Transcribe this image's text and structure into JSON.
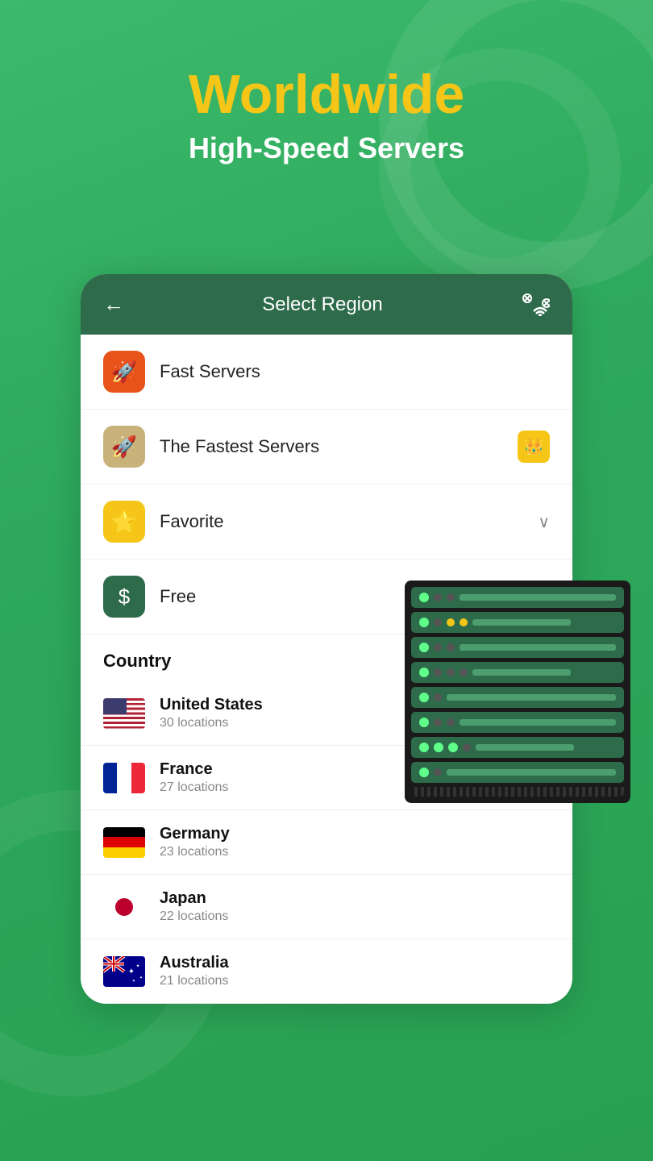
{
  "header": {
    "title": "Worldwide",
    "subtitle": "High-Speed Servers"
  },
  "card": {
    "back_label": "←",
    "title": "Select Region",
    "menu_items": [
      {
        "id": "fast",
        "label": "Fast Servers",
        "icon_type": "orange",
        "icon": "🚀",
        "right": ""
      },
      {
        "id": "fastest",
        "label": "The Fastest Servers",
        "icon_type": "tan",
        "icon": "🚀",
        "right": "crown"
      },
      {
        "id": "favorite",
        "label": "Favorite",
        "icon_type": "yellow",
        "icon": "⭐",
        "right": "chevron"
      },
      {
        "id": "free",
        "label": "Free",
        "icon_type": "green",
        "icon": "💲",
        "right": "chevron"
      }
    ],
    "country_section_label": "Country",
    "countries": [
      {
        "id": "us",
        "name": "United States",
        "locations": "30 locations",
        "flag": "us"
      },
      {
        "id": "fr",
        "name": "France",
        "locations": "27 locations",
        "flag": "fr"
      },
      {
        "id": "de",
        "name": "Germany",
        "locations": "23 locations",
        "flag": "de"
      },
      {
        "id": "jp",
        "name": "Japan",
        "locations": "22 locations",
        "flag": "jp"
      },
      {
        "id": "au",
        "name": "Australia",
        "locations": "21 locations",
        "flag": "au"
      }
    ]
  },
  "colors": {
    "accent_yellow": "#f5c518",
    "header_green": "#2d6b4a",
    "bg_green": "#3cb96a"
  }
}
